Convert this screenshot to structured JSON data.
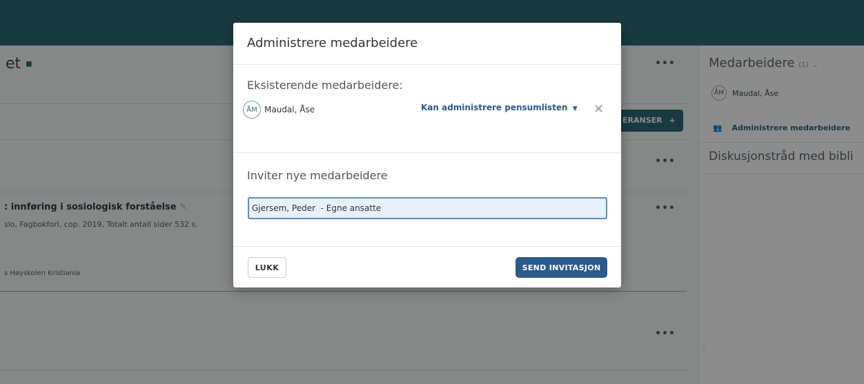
{
  "background": {
    "page_title": "et",
    "references_button_label": "ERANSER",
    "references_button_icon": "+",
    "more_label": "•••",
    "book": {
      "title": ": innføring i sosiologisk forståelse",
      "meta": "slo, Fagbokforl, cop. 2019, Totalt antall sider 532 s.",
      "institution": "s Høyskolen Kristiania"
    },
    "sidebar": {
      "heading": "Medarbeidere",
      "count": "(1)",
      "member_initials": "ÅM",
      "member_name": "Maudal, Åse",
      "admin_link": "Administrere medarbeidere",
      "discussion_heading": "Diskusjonstråd med bibli"
    }
  },
  "modal": {
    "title": "Administrere medarbeidere",
    "existing_heading": "Eksisterende medarbeidere:",
    "existing_members": [
      {
        "initials": "ÅM",
        "name": "Maudal, Åse",
        "permission": "Kan administrere pensumlisten"
      }
    ],
    "invite_heading": "Inviter nye medarbeidere",
    "invite_input_value": "Gjersem, Peder  - Egne ansatte",
    "close_label": "LUKK",
    "send_label": "SEND INVITASJON"
  },
  "colors": {
    "topbar": "#2f6a74",
    "primary_button": "#2c5a8a",
    "overlay": "rgba(0,0,0,0.45)"
  },
  "icons": {
    "remove": "close-icon",
    "dropdown": "caret-down-icon",
    "group": "users-icon",
    "edit": "pencil-icon"
  }
}
